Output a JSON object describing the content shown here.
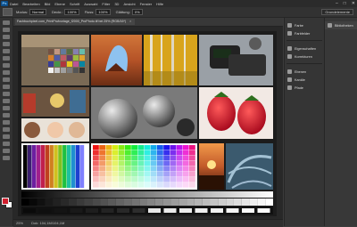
{
  "app": {
    "logo": "Ps"
  },
  "menu": [
    "Datei",
    "Bearbeiten",
    "Bild",
    "Ebene",
    "Schrift",
    "Auswahl",
    "Filter",
    "3D",
    "Ansicht",
    "Fenster",
    "Hilfe"
  ],
  "window_controls": {
    "minimize": "–",
    "maximize": "□",
    "close": "✕"
  },
  "options": {
    "modus_label": "Modus:",
    "modus_value": "Normal",
    "deckkraft_label": "Deckr.:",
    "deckkraft_value": "100%",
    "fluss_label": "Fluss:",
    "fluss_value": "100%",
    "glaettung_label": "Glättung:",
    "glaettung_value": "0%",
    "workspace": "Grundelemente"
  },
  "document": {
    "tab_title": "Fachbuchpixel.com_PrintPrufvorlage_f2000_ProPhoto.tif bei 25% (RGB/16*)",
    "tab_close": "×",
    "status_zoom": "25%",
    "status_doc": "Dok: 104,1M/104,1M"
  },
  "panels_left": [
    {
      "label": "Farbe",
      "icon": "color-icon"
    },
    {
      "label": "Farbfelder",
      "icon": "swatches-icon"
    },
    {
      "label": "Eigenschaften",
      "icon": "properties-icon"
    },
    {
      "label": "Korrekturen",
      "icon": "adjustments-icon"
    },
    {
      "label": "Ebenen",
      "icon": "layers-icon"
    },
    {
      "label": "Kanäle",
      "icon": "channels-icon"
    },
    {
      "label": "Pfade",
      "icon": "paths-icon"
    }
  ],
  "panels_right": [
    {
      "label": "Bibliotheken",
      "icon": "libraries-icon"
    }
  ],
  "colors": {
    "foreground": "#d11f2e",
    "background": "#ffffff",
    "canvas_bg": "#282828"
  },
  "test_image": {
    "gray_steps_upper": 32,
    "gray_steps_lower": 16
  }
}
